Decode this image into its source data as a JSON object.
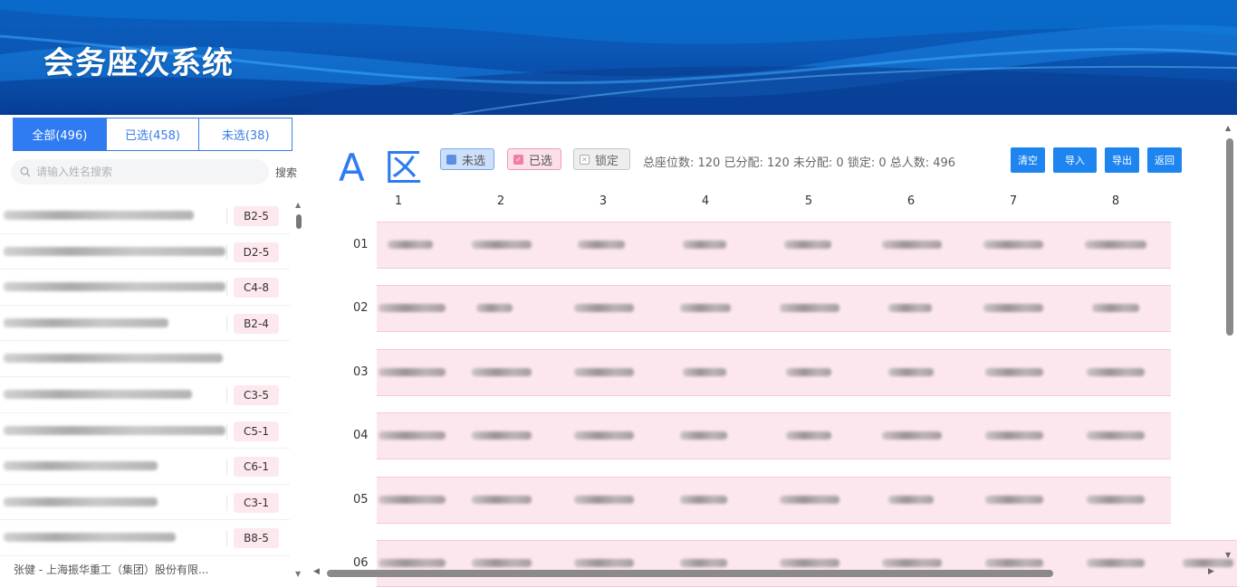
{
  "app": {
    "title": "会务座次系统"
  },
  "sidebar": {
    "tabs": [
      {
        "label": "全部(496)",
        "active": true
      },
      {
        "label": "已选(458)",
        "active": false
      },
      {
        "label": "未选(38)",
        "active": false
      }
    ],
    "search": {
      "placeholder": "请输入姓名搜索",
      "button_label": "搜索"
    },
    "rows": [
      {
        "seat": "B2-5"
      },
      {
        "seat": "D2-5"
      },
      {
        "seat": "C4-8"
      },
      {
        "seat": "B2-4"
      },
      {
        "seat": ""
      },
      {
        "seat": "C3-5"
      },
      {
        "seat": "C5-1"
      },
      {
        "seat": "C6-1"
      },
      {
        "seat": "C3-1"
      },
      {
        "seat": "B8-5"
      }
    ],
    "last_row_text": "张健   -   上海振华重工（集团）股份有限..."
  },
  "main": {
    "zone_title": "A 区",
    "legend": {
      "unselected": "未选",
      "selected": "已选",
      "locked": "锁定"
    },
    "stats": "总座位数: 120 已分配: 120 未分配: 0 锁定: 0 总人数: 496",
    "buttons": {
      "clear": "清空",
      "import": "导入",
      "export": "导出",
      "back": "返回"
    },
    "columns": [
      "1",
      "2",
      "3",
      "4",
      "5",
      "6",
      "7",
      "8"
    ],
    "rows": [
      "01",
      "02",
      "03",
      "04",
      "05",
      "06"
    ]
  },
  "colors": {
    "banner": "#0b57b5",
    "accent": "#2f7bf2",
    "seat_fill": "#fde7ef",
    "button": "#1d84f0"
  }
}
